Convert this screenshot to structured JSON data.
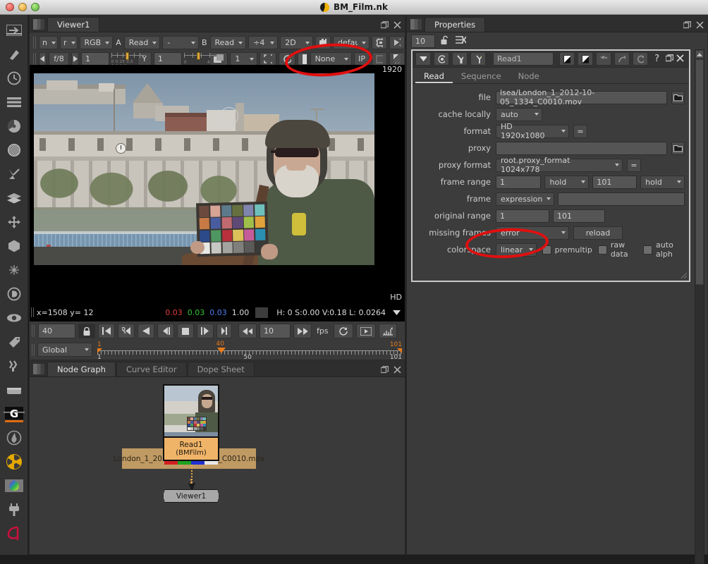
{
  "window": {
    "title": "BM_Film.nk",
    "icon": "nuke-icon",
    "controls": [
      "close-button",
      "minimize-button",
      "zoom-button"
    ]
  },
  "rail": {
    "items": [
      {
        "name": "toolsets-icon"
      },
      {
        "name": "image-icon"
      },
      {
        "name": "draw-icon"
      },
      {
        "name": "time-icon"
      },
      {
        "name": "channel-icon"
      },
      {
        "name": "color-icon"
      },
      {
        "name": "filter-icon"
      },
      {
        "name": "keyer-icon"
      },
      {
        "name": "merge-icon"
      },
      {
        "name": "transform-icon"
      },
      {
        "name": "3d-icon"
      },
      {
        "name": "particles-icon"
      },
      {
        "name": "deep-icon"
      },
      {
        "name": "views-icon"
      },
      {
        "name": "metadata-icon"
      },
      {
        "name": "toolsets2-icon"
      },
      {
        "name": "other-icon"
      },
      {
        "name": "genarts-icon"
      },
      {
        "name": "furnace-icon"
      },
      {
        "name": "ocula-icon"
      },
      {
        "name": "colorchart-icon"
      },
      {
        "name": "plugin-icon"
      },
      {
        "name": "arri-icon"
      }
    ]
  },
  "viewer": {
    "tabs": [
      {
        "label": "Viewer1",
        "active": true
      }
    ],
    "panel_controls": [
      "float-panel-icon",
      "close-panel-icon"
    ],
    "toolbar_row1": {
      "input_n": "n",
      "input_r": "r",
      "channels": "RGB",
      "a_label": "A",
      "a_input": "Read",
      "ab_mode": "-",
      "b_label": "B",
      "b_input": "Read",
      "downres": "÷4",
      "mode": "2D",
      "roi_icon": "roi-icon",
      "viewer_process": "defaul",
      "gl_icon": "gpu-icon",
      "mask_icon": "mask-icon"
    },
    "toolbar_row2": {
      "gain_prev": "prev-icon",
      "gain_label": "f/8",
      "gain_next": "next-icon",
      "gain_value": "1",
      "gain_slider_ticks": "0 0.25 0.5 1 2 4 8",
      "gamma_label": "Y",
      "gamma_value": "1",
      "gamma_slider_min": "0",
      "gamma_slider_max": "4",
      "layer_icon": "layer-icon",
      "proxy_value": "1",
      "roi_btn": "roi-box-icon",
      "refresh_icon": "refresh-icon",
      "wipe_icon": "wipe-icon",
      "overlay": "None",
      "ip_label": "IP",
      "pause_icon": "pause-icon",
      "checker_icon": "checkerboard-icon"
    },
    "image": {
      "format_label_top": "1920",
      "format_label_bottom": "HD",
      "description": "London skyline with bearded man holding colour checker chart"
    },
    "status": {
      "coords": "x=1508 y=  12",
      "r": "0.03",
      "g": "0.03",
      "b": "0.03",
      "a": "1.00",
      "hsvl": "H:  0 S:0.00 V:0.18 L: 0.0264",
      "expand_icon": "chevron-down-icon"
    },
    "transport": {
      "current_frame": "40",
      "lock_icon": "lock-icon",
      "buttons": [
        "first-frame-icon",
        "prev-keyframe-icon",
        "play-backward-icon",
        "step-back-icon",
        "stop-icon",
        "play-forward-icon",
        "last-frame-icon"
      ],
      "fps_back": "rewind-icon",
      "fps_value": "10",
      "fps_fwd": "fastforward-icon",
      "fps_label": "fps",
      "loop_icon": "loop-icon",
      "playmode-icon": "play-range-icon",
      "keys_icon": "frame-increment-icon"
    },
    "timeline": {
      "scope": "Global",
      "in_point": "1",
      "out_point": "101",
      "playhead": "40",
      "start_tick": "1",
      "mid_tick": "50",
      "end_tick": "101"
    }
  },
  "nodegraph": {
    "tabs": [
      {
        "label": "Node Graph",
        "active": true
      },
      {
        "label": "Curve Editor",
        "active": false
      },
      {
        "label": "Dope Sheet",
        "active": false
      }
    ],
    "panel_controls": [
      "float-panel-icon",
      "close-panel-icon"
    ],
    "nodes": [
      {
        "name": "Read1",
        "filename": "London_1_2012-10-05_1334_C0010.mov",
        "meta": "(BMFilm)",
        "color": "#e8a85c",
        "channels": [
          "#d02020",
          "#1fa01f",
          "#2030d0",
          "#e8e8e8"
        ]
      },
      {
        "name": "Viewer1",
        "color": "#9a9a9a"
      }
    ]
  },
  "properties": {
    "tabs": [
      {
        "label": "Properties",
        "active": true
      }
    ],
    "panel_controls": [
      "float-panel-icon",
      "close-panel-icon"
    ],
    "max_panels": "10",
    "lock_icon": "unlock-icon",
    "clear_icon": "clear-all-icon",
    "node": {
      "name": "Read1",
      "header_icons": [
        "collapse-icon",
        "record-icon",
        "node-icon",
        "mask-icon"
      ],
      "right_icons": [
        "swatch-a-icon",
        "swatch-b-icon",
        "undo-icon",
        "redo-icon",
        "revert-icon",
        "help-icon",
        "float-icon",
        "close-icon"
      ],
      "tabs": [
        {
          "label": "Read",
          "active": true
        },
        {
          "label": "Sequence",
          "active": false
        },
        {
          "label": "Node",
          "active": false
        }
      ],
      "knobs": {
        "file_label": "file",
        "file_value": "lsea/London_1_2012-10-05_1334_C0010.mov",
        "cache_label": "cache locally",
        "cache_value": "auto",
        "format_label": "format",
        "format_value": "HD 1920x1080",
        "format_eq": "=",
        "proxy_label": "proxy",
        "proxy_value": "",
        "proxy_format_label": "proxy format",
        "proxy_format_value": "root.proxy_format 1024x778",
        "proxy_format_eq": "=",
        "frame_range_label": "frame range",
        "frame_range_start": "1",
        "frame_range_before": "hold",
        "frame_range_end": "101",
        "frame_range_after": "hold",
        "frame_label": "frame",
        "frame_mode": "expression",
        "frame_expr": "",
        "original_range_label": "original range",
        "original_range_start": "1",
        "original_range_end": "101",
        "missing_frames_label": "missing frames",
        "missing_frames_value": "error",
        "reload_label": "reload",
        "colorspace_label": "colorspace",
        "colorspace_value": "linear",
        "premultiplied_label": "premultip",
        "raw_data_label": "raw data",
        "auto_alpha_label": "auto alph"
      }
    }
  },
  "annotations": {
    "accent_color": "#e10f0f",
    "items": [
      {
        "name": "annotation-overlay-none",
        "target": "viewer overlay dropdown 'None'"
      },
      {
        "name": "annotation-colorspace-linear",
        "target": "colorspace dropdown 'linear'"
      }
    ]
  }
}
